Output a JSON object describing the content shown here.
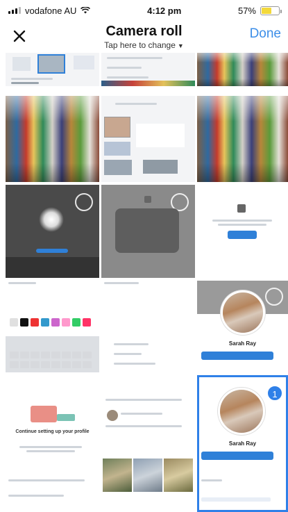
{
  "status_bar": {
    "carrier": "vodafone AU",
    "time": "4:12 pm",
    "battery_percent": "57%",
    "battery_level": 0.57,
    "battery_color": "#f3d93a"
  },
  "nav": {
    "close_icon": "close-icon",
    "title": "Camera roll",
    "subtitle": "Tap here to change",
    "subtitle_caret": "▼",
    "done_label": "Done",
    "done_color": "#3c8ee8"
  },
  "grid": {
    "selected_badge": "1",
    "profile_name": "Sarah Ray",
    "profile_name_selected": "Sarah Ray",
    "onboarding_title": "Continue setting up your profile"
  }
}
